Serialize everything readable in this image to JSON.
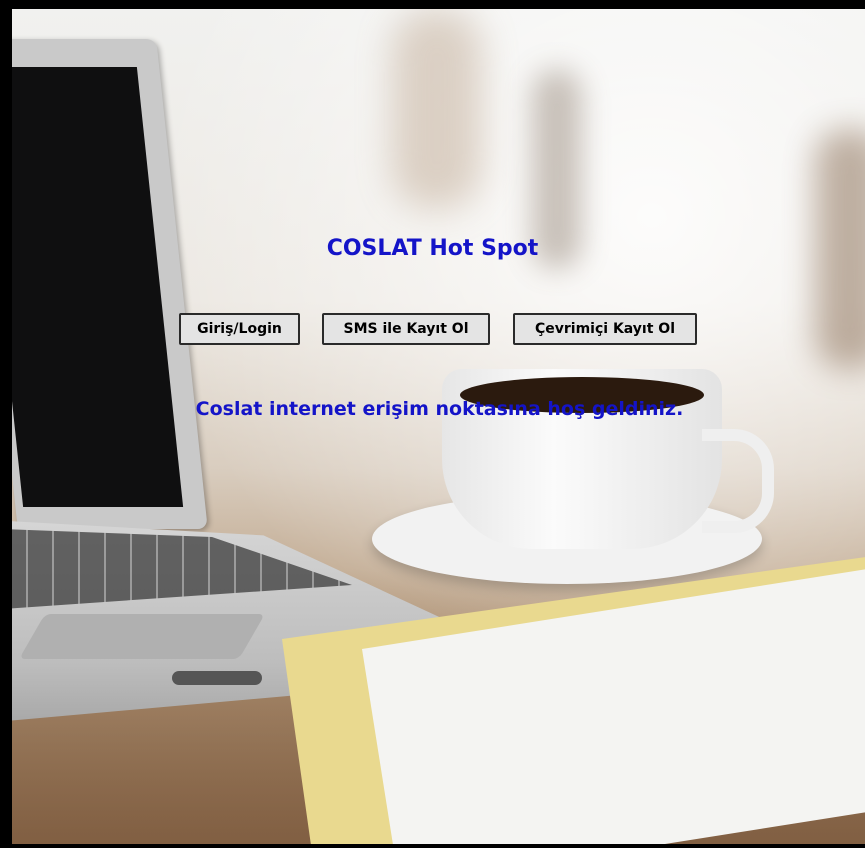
{
  "page": {
    "title": "COSLAT Hot Spot",
    "welcome": "Coslat internet erişim noktasına hoş geldiniz."
  },
  "buttons": {
    "login": "Giriş/Login",
    "sms_register": "SMS ile Kayıt Ol",
    "online_register": "Çevrimiçi Kayıt Ol"
  },
  "colors": {
    "title_text": "#1414c8",
    "frame": "#000000",
    "button_bg": "#e4e4e4"
  }
}
